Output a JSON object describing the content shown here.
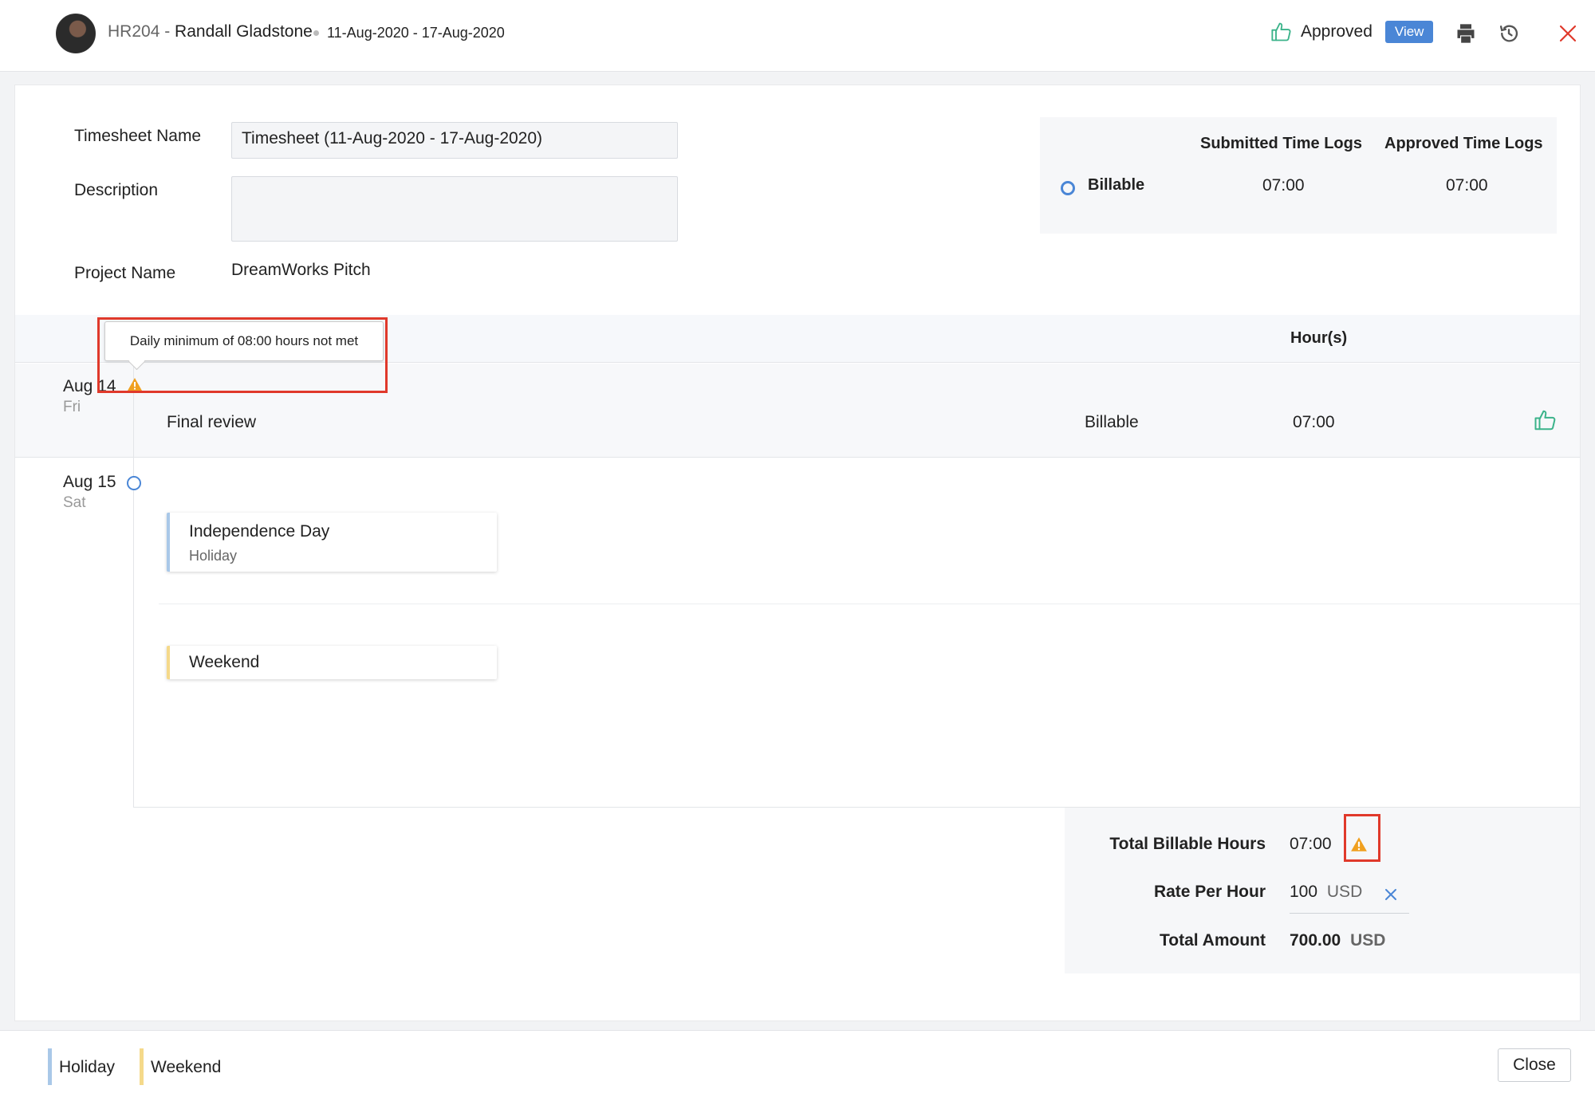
{
  "header": {
    "employee_id": "HR204 -",
    "employee_name": "Randall Gladstone",
    "date_range": "11-Aug-2020 - 17-Aug-2020",
    "status": "Approved",
    "view_label": "View",
    "icons": [
      "thumbs-up-icon",
      "print-icon",
      "history-icon",
      "close-icon"
    ]
  },
  "form": {
    "timesheet_name_label": "Timesheet Name",
    "timesheet_name_value": "Timesheet (11-Aug-2020 - 17-Aug-2020)",
    "description_label": "Description",
    "description_value": "",
    "project_name_label": "Project Name",
    "project_name_value": "DreamWorks Pitch"
  },
  "summary": {
    "col_submitted": "Submitted Time Logs",
    "col_approved": "Approved Time Logs",
    "row_label": "Billable",
    "submitted": "07:00",
    "approved": "07:00"
  },
  "table": {
    "header_hours": "Hour(s)",
    "tooltip": "Daily minimum of 08:00 hours not met",
    "days": [
      {
        "date": "Aug 14",
        "day": "Fri",
        "task": "Final review",
        "billing": "Billable",
        "hours": "07:00"
      },
      {
        "date": "Aug 15",
        "day": "Sat"
      }
    ],
    "cards": [
      {
        "title": "Independence Day",
        "subtitle": "Holiday"
      },
      {
        "title": "Weekend"
      }
    ]
  },
  "totals": {
    "billable_label": "Total Billable Hours",
    "billable_value": "07:00",
    "rate_label": "Rate Per Hour",
    "rate_value": "100",
    "rate_currency": "USD",
    "amount_label": "Total Amount",
    "amount_value": "700.00",
    "amount_currency": "USD"
  },
  "footer": {
    "legend_holiday": "Holiday",
    "legend_weekend": "Weekend",
    "close_label": "Close"
  },
  "colors": {
    "accent": "#4a86d6",
    "approved_green": "#3bb38a",
    "warning": "#f0a020",
    "close_red": "#e0392b",
    "holiday": "#a9c8e8",
    "weekend": "#f5d98a"
  }
}
